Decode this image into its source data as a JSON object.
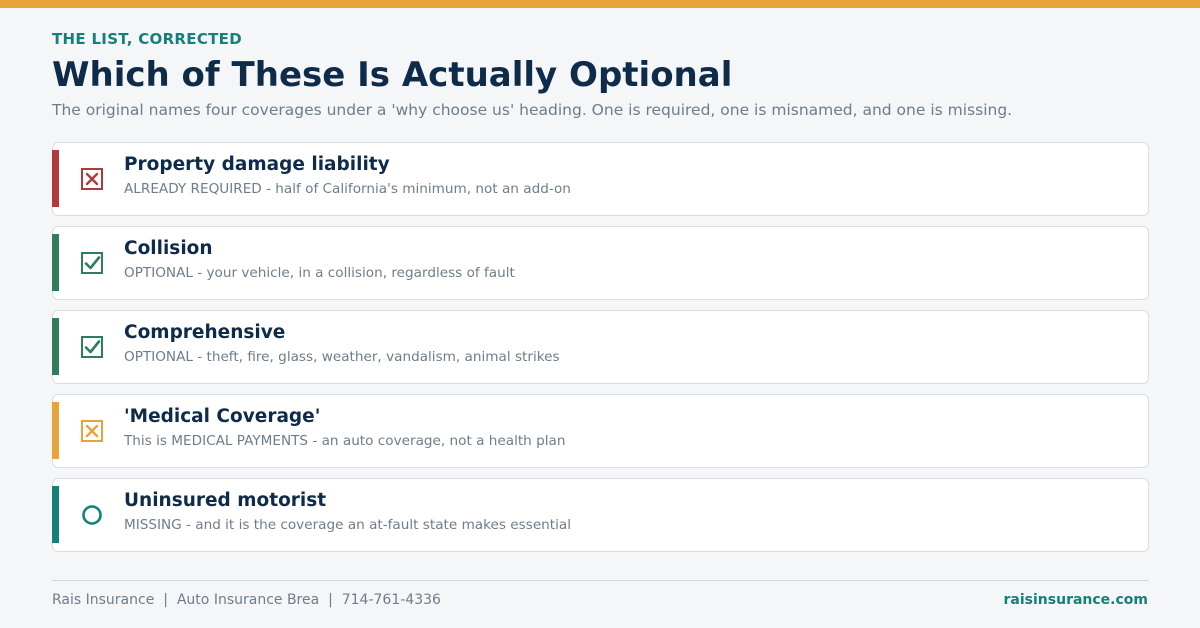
{
  "colors": {
    "top_bar": "#e8a33a",
    "accent_red": "#b03a3a",
    "accent_green": "#2e7d5b",
    "accent_orange": "#e8a33a",
    "accent_teal": "#13817a",
    "navy": "#0f2b4a",
    "muted_text": "#6e7d8c"
  },
  "header": {
    "eyebrow": "THE LIST, CORRECTED",
    "title": "Which of These Is Actually Optional",
    "subtitle": "The original names four coverages under a 'why choose us' heading. One is required, one is misnamed, and one is missing."
  },
  "coverages": [
    {
      "title": "Property damage liability",
      "description": "ALREADY REQUIRED - half of California's minimum, not an add-on",
      "icon": "x-box-icon",
      "status": "required",
      "accent": "#b03a3a"
    },
    {
      "title": "Collision",
      "description": "OPTIONAL - your vehicle, in a collision, regardless of fault",
      "icon": "check-box-icon",
      "status": "optional",
      "accent": "#2e7d5b"
    },
    {
      "title": "Comprehensive",
      "description": "OPTIONAL - theft, fire, glass, weather, vandalism, animal strikes",
      "icon": "check-box-icon",
      "status": "optional",
      "accent": "#2e7d5b"
    },
    {
      "title": "'Medical Coverage'",
      "description": "This is MEDICAL PAYMENTS - an auto coverage, not a health plan",
      "icon": "x-box-icon",
      "status": "misnamed",
      "accent": "#e8a33a"
    },
    {
      "title": "Uninsured motorist",
      "description": "MISSING - and it is the coverage an at-fault state makes essential",
      "icon": "empty-circle-icon",
      "status": "missing",
      "accent": "#13817a"
    }
  ],
  "footer": {
    "company": "Rais Insurance",
    "separator": "|",
    "tagline": "Auto Insurance Brea",
    "phone": "714-761-4336",
    "website": "raisinsurance.com"
  }
}
